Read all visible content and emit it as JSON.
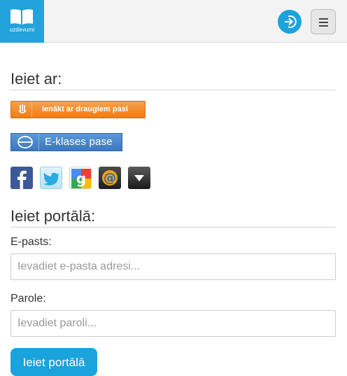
{
  "header": {
    "logo_text": "uzdevumi",
    "login_icon": "sign-in-icon",
    "menu_icon": "hamburger-menu-icon",
    "accent_color": "#1aa3dd"
  },
  "login_with": {
    "title": "Ieiet ar:",
    "draugiem_label": "Ienākt ar draugiem pasi",
    "eklase_label": "E-klases pase",
    "social_icons": [
      "facebook-icon",
      "twitter-icon",
      "google-icon",
      "email-icon",
      "more-dropdown-icon"
    ]
  },
  "portal_login": {
    "title": "Ieiet portālā:",
    "email_label": "E-pasts:",
    "email_placeholder": "Ievadiet e-pasta adresi...",
    "password_label": "Parole:",
    "password_placeholder": "Ievadiet paroli...",
    "submit_label": "Ieiet portālā"
  }
}
